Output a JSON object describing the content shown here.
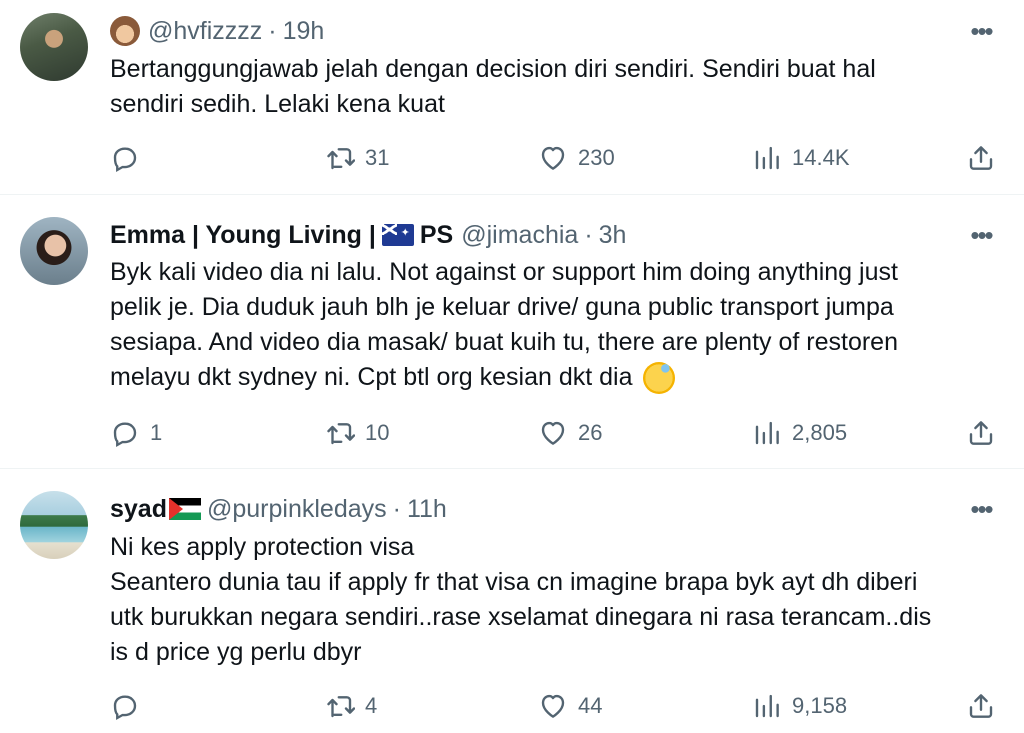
{
  "tweets": [
    {
      "name": "",
      "handle": "@hvfizzzz",
      "time": "19h",
      "avatar_icon": "profile-photo",
      "name_emoji": "see-no-evil-monkey-emoji",
      "text_lines": [
        "Bertanggungjawab jelah dengan decision diri sendiri. Sendiri buat hal",
        "sendiri sedih. Lelaki kena kuat"
      ],
      "replies": "",
      "retweets": "31",
      "likes": "230",
      "views": "14.4K"
    },
    {
      "name": "Emma | Young Living |",
      "name_suffix": "PS",
      "handle": "@jimachia",
      "time": "3h",
      "avatar_icon": "profile-photo",
      "name_emoji": "australia-flag",
      "text_lines": [
        "Byk kali video dia ni lalu. Not against or support him doing anything just",
        "pelik je. Dia duduk jauh blh je keluar drive/ guna public transport jumpa",
        "sesiapa. And video dia masak/ buat kuih tu, there are plenty of restoren",
        "melayu dkt sydney ni. Cpt btl org kesian dkt dia"
      ],
      "trailing_emoji": "grinning-sweat-emoji",
      "replies": "1",
      "retweets": "10",
      "likes": "26",
      "views": "2,805"
    },
    {
      "name": "syad",
      "handle": "@purpinkledays",
      "time": "11h",
      "avatar_icon": "profile-photo",
      "name_emoji": "palestine-flag",
      "text_lines": [
        "Ni kes apply protection visa",
        "Seantero dunia tau if apply fr that visa cn imagine brapa byk ayt dh diberi",
        "utk burukkan negara sendiri..rase xselamat dinegara ni rasa terancam..dis",
        "is d price yg perlu dbyr"
      ],
      "replies": "",
      "retweets": "4",
      "likes": "44",
      "views": "9,158"
    }
  ],
  "ui": {
    "dot": "·",
    "more": "•••"
  },
  "colors": {
    "text": "#0f1419",
    "secondary": "#536471",
    "divider": "#eff3f4"
  }
}
